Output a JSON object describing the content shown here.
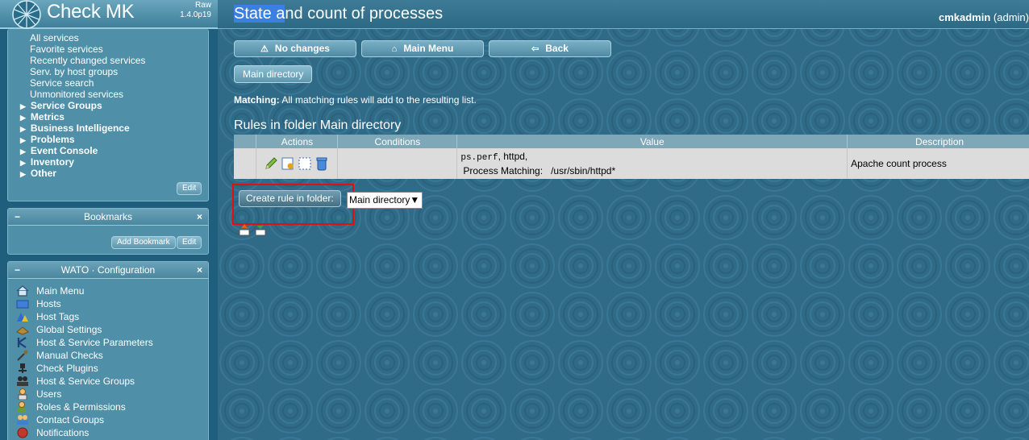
{
  "sidebar": {
    "logo": {
      "text": "Check MK",
      "edition": "Raw",
      "version": "1.4.0p19"
    },
    "views": {
      "items": [
        "All services",
        "Favorite services",
        "Recently changed services",
        "Serv. by host groups",
        "Service search",
        "Unmonitored services"
      ],
      "groups": [
        "Service Groups",
        "Metrics",
        "Business Intelligence",
        "Problems",
        "Event Console",
        "Inventory",
        "Other"
      ],
      "edit_label": "Edit"
    },
    "bookmarks": {
      "title": "Bookmarks",
      "add_label": "Add Bookmark",
      "edit_label": "Edit"
    },
    "wato": {
      "title": "WATO · Configuration",
      "items": [
        {
          "label": "Main Menu",
          "icon": "home-icon"
        },
        {
          "label": "Hosts",
          "icon": "folder-icon"
        },
        {
          "label": "Host Tags",
          "icon": "tags-icon"
        },
        {
          "label": "Global Settings",
          "icon": "settings-icon"
        },
        {
          "label": "Host & Service Parameters",
          "icon": "rulesets-icon"
        },
        {
          "label": "Manual Checks",
          "icon": "wrench-icon"
        },
        {
          "label": "Check Plugins",
          "icon": "plugin-icon"
        },
        {
          "label": "Host & Service Groups",
          "icon": "groups-icon"
        },
        {
          "label": "Users",
          "icon": "users-icon"
        },
        {
          "label": "Roles & Permissions",
          "icon": "roles-icon"
        },
        {
          "label": "Contact Groups",
          "icon": "contactgroups-icon"
        },
        {
          "label": "Notifications",
          "icon": "notifications-icon"
        }
      ]
    }
  },
  "header": {
    "title_selected": "State a",
    "title_rest": "nd count of processes",
    "user": "cmkadmin",
    "role": "(admin)"
  },
  "toolbar": {
    "no_changes": "No changes",
    "main_menu": "Main Menu",
    "back": "Back"
  },
  "folder_button": "Main directory",
  "matching": {
    "label": "Matching:",
    "text": "All matching rules will add to the resulting list."
  },
  "rules": {
    "heading": "Rules in folder Main directory",
    "columns": [
      "Actions",
      "Conditions",
      "Value",
      "Description"
    ],
    "rows": [
      {
        "value_code": "ps.perf",
        "value_rest": ", httpd,",
        "value_line2_label": "Process Matching:",
        "value_line2_value": "/usr/sbin/httpd*",
        "description": "Apache count process"
      }
    ]
  },
  "create_rule": {
    "button": "Create rule in folder:",
    "selected_folder": "Main directory"
  },
  "colors": {
    "background": "#2f6a86",
    "highlight": "#e01010",
    "table_row": "#dcdcdc"
  }
}
